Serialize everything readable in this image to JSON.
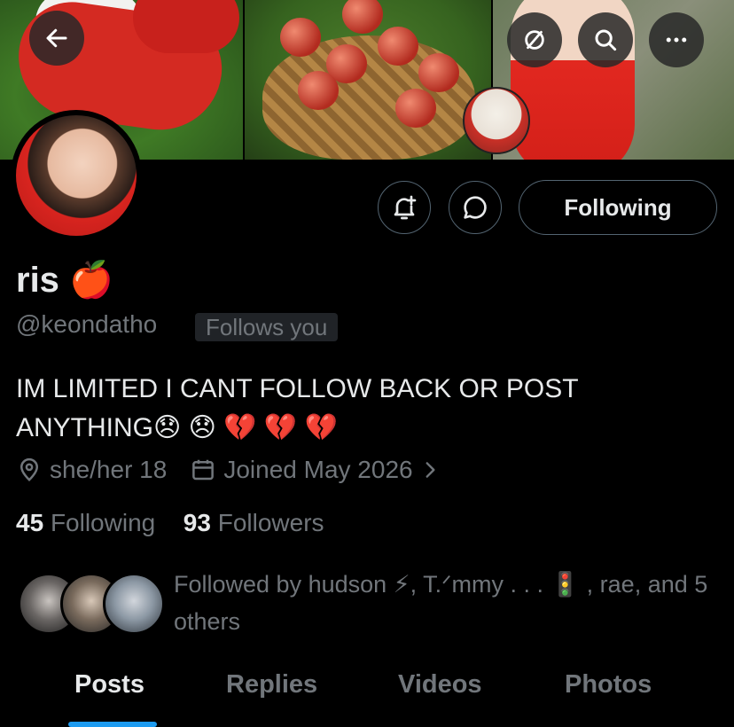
{
  "header": {
    "back_icon": "arrow-left-icon",
    "hide_icon": "eye-slash-icon",
    "search_icon": "search-icon",
    "more_icon": "more-horizontal-icon"
  },
  "actions": {
    "notify_icon": "bell-plus-icon",
    "message_icon": "message-bubble-icon",
    "following_label": "Following"
  },
  "profile": {
    "name": "ris 🍎",
    "handle": "@keondatho",
    "follows_you": "Follows you",
    "bio": "IM LIMITED I CANT FOLLOW BACK OR POST ANYTHING😞 😞 💔 💔 💔",
    "pronouns": "she/her 18",
    "joined": "Joined May 2026",
    "following_count": "45",
    "following_label": "Following",
    "followers_count": "93",
    "followers_label": "Followers",
    "followed_by": "Followed by hudson ⚡, T.ᐟmmy . . . 🚦 , rae, and 5 others"
  },
  "tabs": [
    {
      "label": "Posts"
    },
    {
      "label": "Replies"
    },
    {
      "label": "Videos"
    },
    {
      "label": "Photos"
    }
  ],
  "colors": {
    "background": "#000000",
    "text_primary": "#e7e9ea",
    "text_secondary": "#71767b",
    "accent": "#1d9bf0",
    "border": "#536471"
  }
}
